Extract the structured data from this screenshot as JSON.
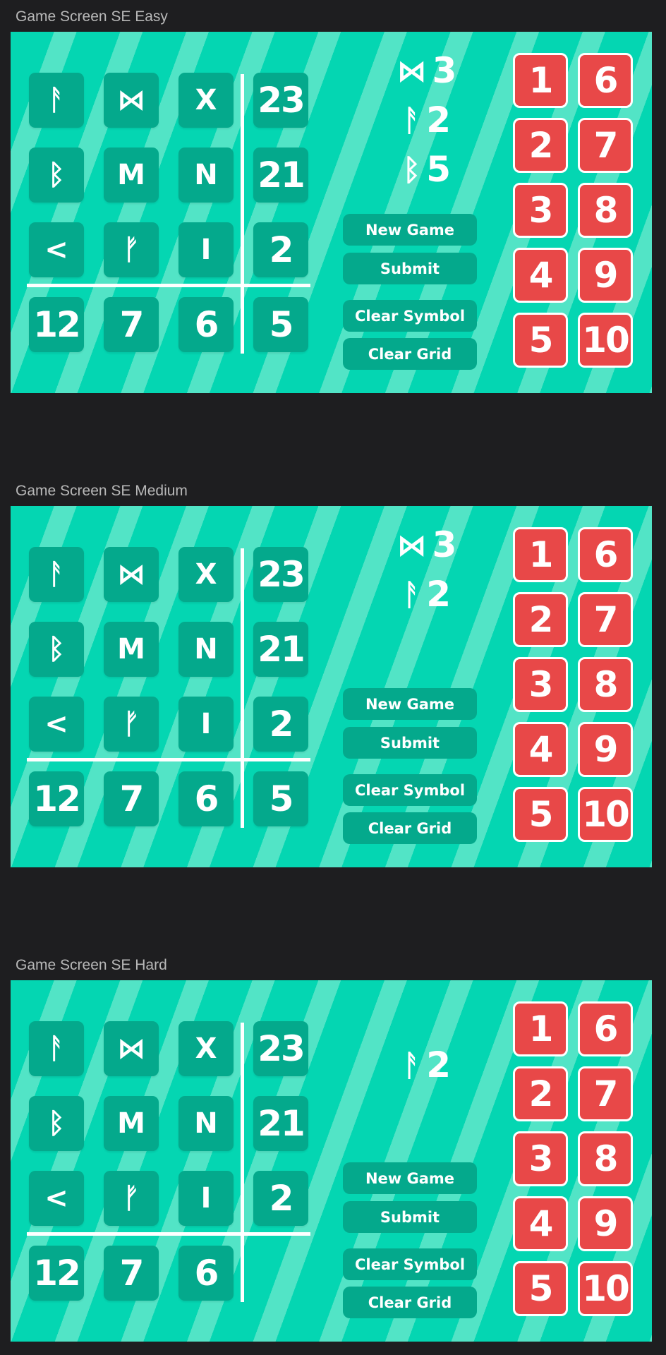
{
  "colors": {
    "background": "#1e1e20",
    "screen_teal": "#04d6b2",
    "stripe_teal": "#52e4c6",
    "tile": "#04a98c",
    "key_red": "#e84848",
    "text_white": "#ffffff"
  },
  "screens": [
    {
      "label": "Game Screen SE Easy",
      "grid": [
        "ᚨ",
        "⋈",
        "X",
        "ᛒ",
        "M",
        "N",
        "<",
        "ᚠ",
        "I"
      ],
      "row_sums": [
        "23",
        "21",
        "2"
      ],
      "col_sums": [
        "12",
        "7",
        "6",
        "5"
      ],
      "clues": [
        {
          "symbol": "⋈",
          "value": "3"
        },
        {
          "symbol": "ᚨ",
          "value": "2"
        },
        {
          "symbol": "ᛒ",
          "value": "5"
        }
      ],
      "buttons": {
        "new_game": "New Game",
        "submit": "Submit",
        "clear_symbol": "Clear Symbol",
        "clear_grid": "Clear Grid"
      },
      "keys": [
        "1",
        "6",
        "2",
        "7",
        "3",
        "8",
        "4",
        "9",
        "5",
        "10"
      ]
    },
    {
      "label": "Game Screen SE Medium",
      "grid": [
        "ᚨ",
        "⋈",
        "X",
        "ᛒ",
        "M",
        "N",
        "<",
        "ᚠ",
        "I"
      ],
      "row_sums": [
        "23",
        "21",
        "2"
      ],
      "col_sums": [
        "12",
        "7",
        "6",
        "5"
      ],
      "clues": [
        {
          "symbol": "⋈",
          "value": "3"
        },
        {
          "symbol": "ᚨ",
          "value": "2"
        }
      ],
      "buttons": {
        "new_game": "New Game",
        "submit": "Submit",
        "clear_symbol": "Clear Symbol",
        "clear_grid": "Clear Grid"
      },
      "keys": [
        "1",
        "6",
        "2",
        "7",
        "3",
        "8",
        "4",
        "9",
        "5",
        "10"
      ]
    },
    {
      "label": "Game Screen SE Hard",
      "grid": [
        "ᚨ",
        "⋈",
        "X",
        "ᛒ",
        "M",
        "N",
        "<",
        "ᚠ",
        "I"
      ],
      "row_sums": [
        "23",
        "21",
        "2"
      ],
      "col_sums": [
        "12",
        "7",
        "6"
      ],
      "clues": [
        {
          "symbol": "ᚨ",
          "value": "2"
        }
      ],
      "buttons": {
        "new_game": "New Game",
        "submit": "Submit",
        "clear_symbol": "Clear Symbol",
        "clear_grid": "Clear Grid"
      },
      "keys": [
        "1",
        "6",
        "2",
        "7",
        "3",
        "8",
        "4",
        "9",
        "5",
        "10"
      ]
    }
  ]
}
